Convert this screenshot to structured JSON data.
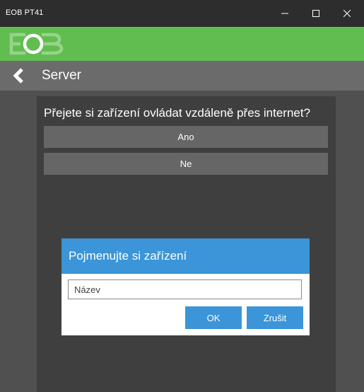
{
  "window": {
    "title": "EOB PT41",
    "icons": {
      "minimize": "minimize-icon",
      "maximize": "maximize-icon",
      "close": "close-icon"
    }
  },
  "brand": {
    "logo_text": "EOB",
    "color": "#62bd51"
  },
  "nav": {
    "back_icon": "chevron-left-icon",
    "title": "Server"
  },
  "question": {
    "text": "Přejete si zařízení ovládat vzdáleně přes internet?",
    "options": [
      {
        "label": "Ano"
      },
      {
        "label": "Ne"
      }
    ]
  },
  "dialog": {
    "title": "Pojmenujte si zařízení",
    "input": {
      "value": "",
      "placeholder": "Název"
    },
    "ok_label": "OK",
    "cancel_label": "Zrušit",
    "accent_color": "#3b95d8"
  }
}
